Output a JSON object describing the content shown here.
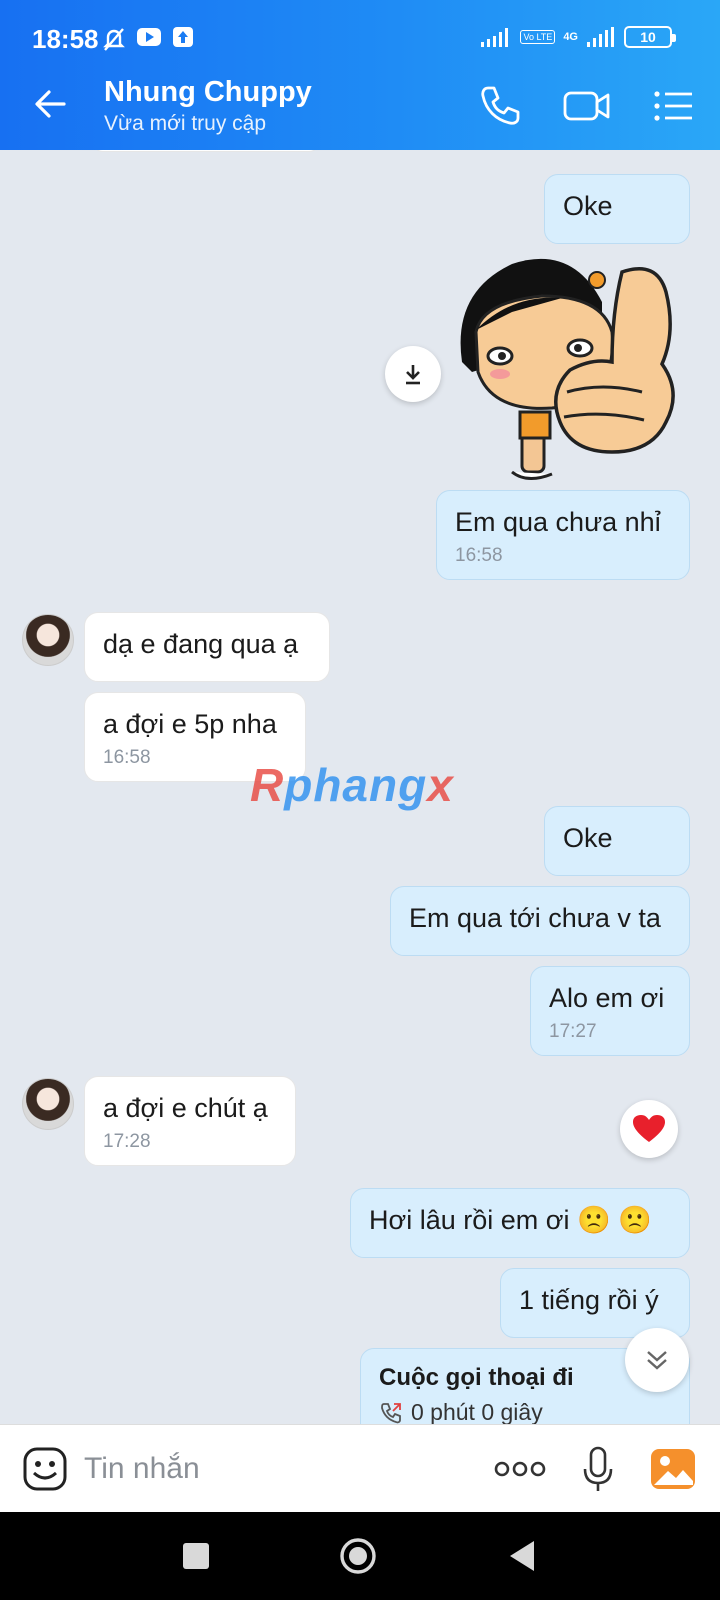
{
  "status_bar": {
    "time": "18:58",
    "network": "4G",
    "volte_label": "Vo LTE",
    "battery": "10"
  },
  "header": {
    "contact_name": "Nhung Chuppy",
    "presence": "Vừa mới truy cập"
  },
  "messages": [
    {
      "dir": "out",
      "text": "Oke",
      "time": ""
    },
    {
      "dir": "out",
      "type": "sticker",
      "sticker": "thumbs-up-girl",
      "text": "",
      "time": ""
    },
    {
      "dir": "out",
      "text": "Em qua chưa nhỉ",
      "time": "16:58"
    },
    {
      "dir": "in",
      "text": "dạ e đang qua ạ",
      "time": ""
    },
    {
      "dir": "in",
      "text": "a đợi e 5p nha",
      "time": "16:58"
    },
    {
      "dir": "out",
      "text": "Oke",
      "time": ""
    },
    {
      "dir": "out",
      "text": "Em qua tới chưa v ta",
      "time": ""
    },
    {
      "dir": "out",
      "text": "Alo em ơi",
      "time": "17:27"
    },
    {
      "dir": "in",
      "text": "a đợi e chút ạ",
      "time": "17:28"
    },
    {
      "dir": "out",
      "text": "Hơi lâu rồi em ơi 🙁 🙁",
      "time": ""
    },
    {
      "dir": "out",
      "text": "1 tiếng rồi ý",
      "time": ""
    },
    {
      "dir": "out",
      "type": "call",
      "text": "Cuộc gọi thoại đi",
      "detail": "0 phút 0 giây",
      "time": ""
    }
  ],
  "watermark": {
    "part1": "R",
    "part2": "phang",
    "part3": "x"
  },
  "composer": {
    "placeholder": "Tin nhắn"
  },
  "colors": {
    "header_start": "#1770f2",
    "header_end": "#2aa7f7",
    "outgoing_bubble": "#d8eefd",
    "incoming_bubble": "#ffffff",
    "chat_background": "#e3e8ef"
  },
  "icons": [
    "back-arrow-icon",
    "phone-icon",
    "video-call-icon",
    "menu-list-icon",
    "download-icon",
    "heart-reaction-icon",
    "scroll-down-icon",
    "sticker-emoji-icon",
    "more-dots-icon",
    "microphone-icon",
    "gallery-icon"
  ]
}
